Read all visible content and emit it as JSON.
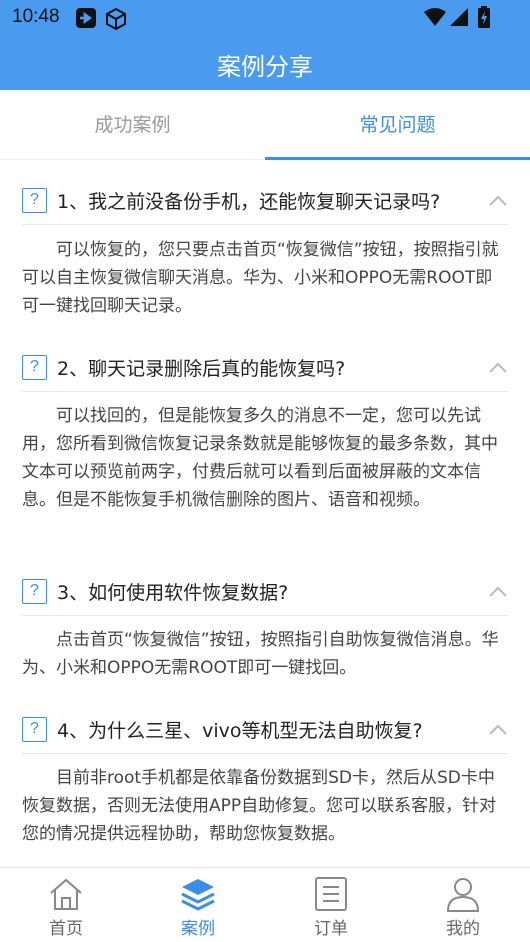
{
  "status_bar": {
    "time": "10:48"
  },
  "header": {
    "title": "案例分享"
  },
  "tabs": [
    {
      "label": "成功案例",
      "active": false
    },
    {
      "label": "常见问题",
      "active": true
    }
  ],
  "faq": [
    {
      "question": "1、我之前没备份手机，还能恢复聊天记录吗?",
      "answer": "可以恢复的，您只要点击首页“恢复微信”按钮，按照指引就可以自主恢复微信聊天消息。华为、小米和OPPO无需ROOT即可一键找回聊天记录。"
    },
    {
      "question": "2、聊天记录删除后真的能恢复吗?",
      "answer": "可以找回的，但是能恢复多久的消息不一定，您可以先试用，您所看到微信恢复记录条数就是能够恢复的最多条数，其中文本可以预览前两字，付费后就可以看到后面被屏蔽的文本信息。但是不能恢复手机微信删除的图片、语音和视频。"
    },
    {
      "question": "3、如何使用软件恢复数据?",
      "answer": "点击首页“恢复微信”按钮，按照指引自助恢复微信消息。华为、小米和OPPO无需ROOT即可一键找回。"
    },
    {
      "question": "4、为什么三星、vivo等机型无法自助恢复?",
      "answer": "目前非root手机都是依靠备份数据到SD卡，然后从SD卡中恢复数据，否则无法使用APP自助修复。您可以联系客服，针对您的情况提供远程协助，帮助您恢复数据。"
    }
  ],
  "question_icon": "?",
  "bottom_nav": [
    {
      "label": "首页",
      "icon": "home-icon",
      "active": false
    },
    {
      "label": "案例",
      "icon": "layers-icon",
      "active": true
    },
    {
      "label": "订单",
      "icon": "order-icon",
      "active": false
    },
    {
      "label": "我的",
      "icon": "user-icon",
      "active": false
    }
  ],
  "colors": {
    "primary": "#4a9bf0",
    "accent": "#3a8ee6",
    "inactive": "#9a9a9a"
  }
}
